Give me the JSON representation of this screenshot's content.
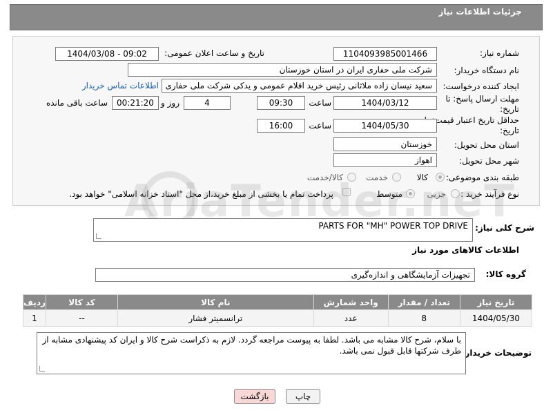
{
  "header": {
    "title": "جزئیات اطلاعات نیاز"
  },
  "form": {
    "need_number": {
      "label": "شماره نیاز:",
      "value": "1104093985001466"
    },
    "announce_datetime": {
      "label": "تاریخ و ساعت اعلان عمومی:",
      "value": "1404/03/08 - 09:02"
    },
    "buyer_org": {
      "label": "نام دستگاه خریدار:",
      "value": "شرکت ملی حفاری ایران در استان خوزستان"
    },
    "requester": {
      "label": "ایجاد کننده درخواست:",
      "value": "سعید نیسان زاده ملاثانی رئیس خرید اقلام عمومی و یدکی شرکت ملی حفاری",
      "contact_link": "اطلاعات تماس خریدار"
    },
    "reply_deadline": {
      "label": "مهلت ارسال پاسخ: تا تاریخ:",
      "date": "1404/03/12",
      "time_label": "ساعت",
      "time": "09:30",
      "days": "4",
      "days_label": "روز و",
      "remaining": "00:21:20",
      "remaining_label": "ساعت باقی مانده"
    },
    "price_validity": {
      "label": "حداقل تاریخ اعتبار قیمت: تا تاریخ:",
      "date": "1404/05/30",
      "time_label": "ساعت",
      "time": "16:00"
    },
    "delivery_province": {
      "label": "استان محل تحویل:",
      "value": "خوزستان"
    },
    "delivery_city": {
      "label": "شهر محل تحویل:",
      "value": "اهواز"
    },
    "category": {
      "label": "طبقه بندی موضوعی:",
      "options": [
        "کالا",
        "خدمت",
        "کالا/خدمت"
      ],
      "selected": "کالا"
    },
    "process_type": {
      "label": "نوع فرآیند خرید :",
      "options": [
        "جزیی",
        "متوسط"
      ],
      "selected": "متوسط",
      "payment_note": "پرداخت تمام یا بخشی از مبلغ خرید،از محل \"اسناد خزانه اسلامی\" خواهد بود."
    }
  },
  "watermark": "AriaTender.neT",
  "description": {
    "label": "شرح کلی نیاز:",
    "value": "PARTS FOR \"MH\" POWER TOP DRIVE"
  },
  "items_section": {
    "title": "اطلاعات کالاهای مورد نیاز",
    "group_label": "گروه کالا:",
    "group_value": "تجهیزات آزمایشگاهی و اندازه‌گیری",
    "columns": [
      "ردیف",
      "کد کالا",
      "نام کالا",
      "واحد شمارش",
      "تعداد / مقدار",
      "تاریخ نیاز"
    ],
    "rows": [
      {
        "row": "1",
        "code": "--",
        "name": "ترانسمیتر فشار",
        "unit": "عدد",
        "qty": "8",
        "date": "1404/05/30"
      }
    ]
  },
  "buyer_notes": {
    "label": "توضیحات خریدار:",
    "value": "با سلام، شرح کالا مشابه می باشد. لطفا به پیوست مراجعه گردد. لازم به ذکراست شرح کالا و ایران کد  پیشنهادی مشابه از طرف شرکتها قابل قبول نمی باشد."
  },
  "buttons": {
    "print": "چاپ",
    "back": "بازگشت"
  },
  "colors": {
    "header_bg": "#8a8a8a",
    "link": "#1a5fb4",
    "back_button_bg": "#f8d7d7"
  }
}
